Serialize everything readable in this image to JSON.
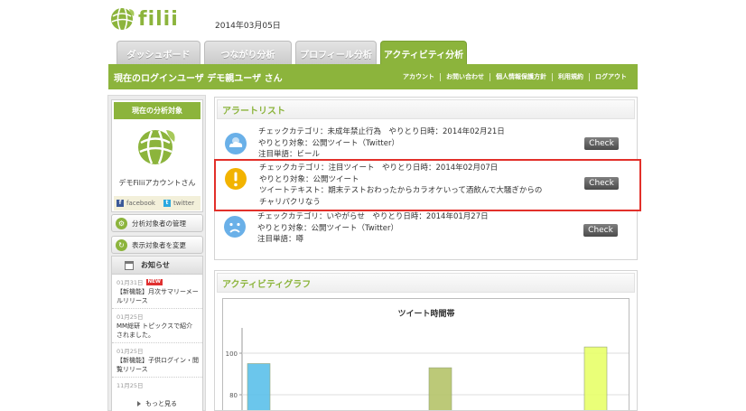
{
  "header": {
    "logo_text": "filii",
    "date": "2014年03月05日"
  },
  "tabs": [
    {
      "label": "ダッシュボード",
      "active": false
    },
    {
      "label": "つながり分析",
      "active": false
    },
    {
      "label": "プロフィール分析",
      "active": false
    },
    {
      "label": "アクティビティ分析",
      "active": true
    }
  ],
  "userbar": {
    "title": "現在のログインユーザ デモ親ユーザ さん",
    "nav": [
      "アカウント",
      "お問い合わせ",
      "個人情報保護方針",
      "利用規約",
      "ログアウト"
    ]
  },
  "sidebar": {
    "target_title": "現在の分析対象",
    "target_name": "デモFiliiアカウントさん",
    "facebook_label": "facebook",
    "twitter_label": "twitter",
    "manage_button": "分析対象者の管理",
    "switch_button": "表示対象者を変更",
    "news_title": "お知らせ",
    "new_badge": "NEW",
    "news": [
      {
        "date": "01月31日",
        "is_new": true,
        "text": "【新機能】月次サマリーメールリリース"
      },
      {
        "date": "01月25日",
        "is_new": false,
        "text": "MM総研 トピックスで紹介されました。"
      },
      {
        "date": "01月25日",
        "is_new": false,
        "text": "【新機能】子供ログイン・閲覧リリース"
      },
      {
        "date": "11月25日",
        "is_new": false,
        "text": ""
      }
    ],
    "more_label": "もっと見る"
  },
  "alerts": {
    "title": "アラートリスト",
    "check_label": "Check",
    "items": [
      {
        "icon": "cloudy-icon",
        "lines": [
          "チェックカテゴリ：未成年禁止行為　やりとり日時：2014年02月21日",
          "やりとり対象：公開ツイート（Twitter）",
          "注目単語：ビール"
        ]
      },
      {
        "icon": "warning-icon",
        "highlighted": true,
        "lines": [
          "チェックカテゴリ：注目ツイート　やりとり日時：2014年02月07日",
          "やりとり対象：公開ツイート",
          "ツイートテキスト：期末テストおわったからカラオケいって酒飲んで大騒ぎからの",
          "チャリパクリなう"
        ]
      },
      {
        "icon": "sad-face-icon",
        "lines": [
          "チェックカテゴリ：いやがらせ　やりとり日時：2014年01月27日",
          "やりとり対象：公開ツイート（Twitter）",
          "注目単語：噂"
        ]
      }
    ]
  },
  "graph": {
    "title": "アクティビティグラフ"
  },
  "chart_data": {
    "type": "bar",
    "title": "ツイート時間帯",
    "y_ticks": [
      100,
      80
    ],
    "ylim": [
      0,
      100
    ],
    "bars": [
      {
        "value": 95,
        "color": "#5bc0eb"
      },
      {
        "value": 93,
        "color": "#b5c46a"
      },
      {
        "value": 103,
        "color": "#e8ff6a"
      }
    ],
    "colors": {
      "accent": "#8cb43c"
    }
  }
}
